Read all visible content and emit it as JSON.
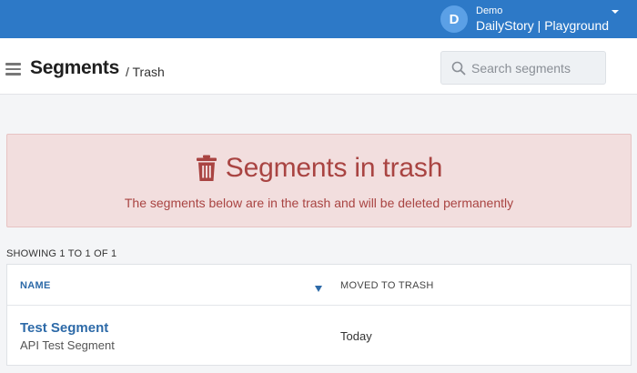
{
  "account": {
    "avatar_letter": "D",
    "label": "Demo",
    "name": "DailyStory | Playground"
  },
  "header": {
    "title": "Segments",
    "breadcrumb": "/ Trash"
  },
  "search": {
    "placeholder": "Search segments"
  },
  "alert": {
    "title": "Segments in trash",
    "message": "The segments below are in the trash and will be deleted permanently"
  },
  "listing": {
    "showing": "SHOWING 1 TO 1 OF 1"
  },
  "table": {
    "columns": [
      "NAME",
      "MOVED TO TRASH"
    ],
    "rows": [
      {
        "name": "Test Segment",
        "description": "API Test Segment",
        "moved": "Today"
      }
    ]
  },
  "colors": {
    "topbar": "#2d79c7",
    "alert_bg": "#f2dede",
    "alert_text": "#a94442",
    "link": "#2d6aa8"
  },
  "icons": [
    "menu-icon",
    "search-icon",
    "trash-icon",
    "chevron-down-icon",
    "sort-desc-icon"
  ]
}
